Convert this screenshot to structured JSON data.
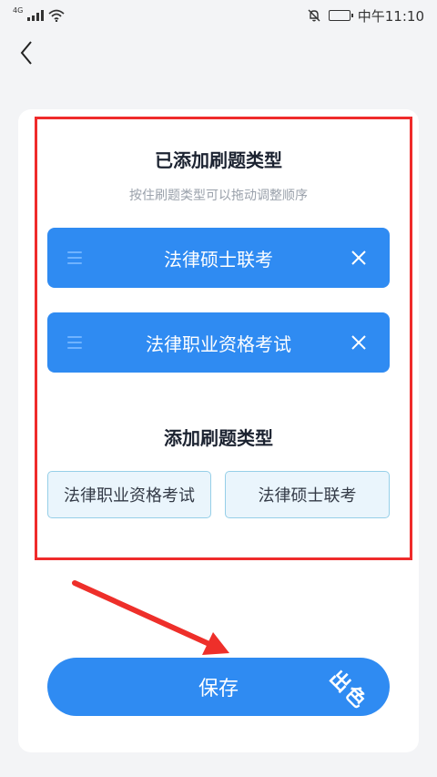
{
  "status_bar": {
    "network": "4G",
    "time": "中午11:10"
  },
  "header": {
    "back_icon": "chevron-left-icon"
  },
  "added_section": {
    "title": "已添加刷题类型",
    "hint": "按住刷题类型可以拖动调整顺序",
    "items": [
      {
        "label": "法律硕士联考"
      },
      {
        "label": "法律职业资格考试"
      }
    ]
  },
  "add_section": {
    "title": "添加刷题类型",
    "options": [
      {
        "label": "法律职业资格考试"
      },
      {
        "label": "法律硕士联考"
      }
    ]
  },
  "save_label": "保存",
  "watermark": "出色",
  "colors": {
    "accent": "#2f8bf2",
    "highlight": "#ef2b2b",
    "chip_border": "#96cfe8"
  }
}
